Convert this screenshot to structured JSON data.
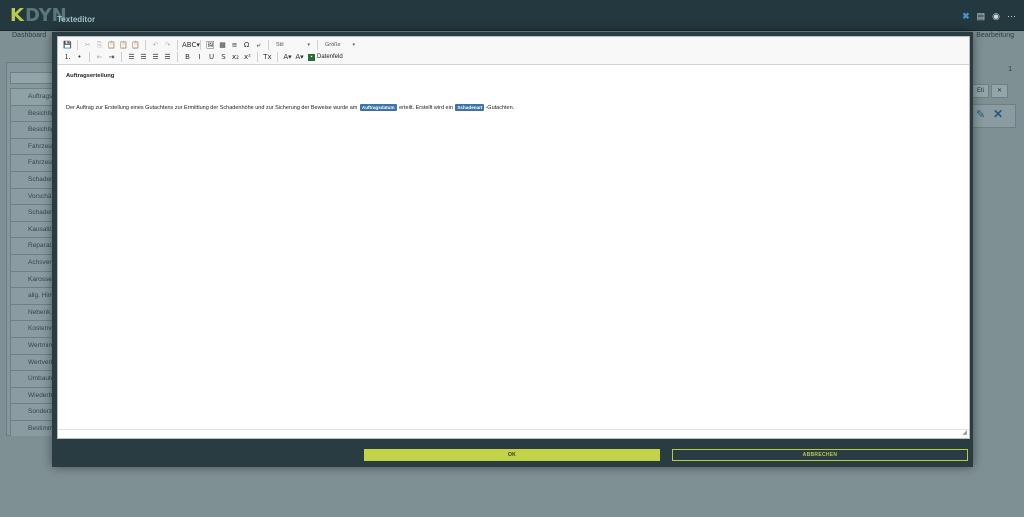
{
  "app": {
    "logo_text": "DYN",
    "logo_mark": "K",
    "subtitle": "Texteditor",
    "top_icons": [
      "close-icon",
      "save-icon",
      "globe-icon",
      "more-icon"
    ]
  },
  "background": {
    "breadcrumb_left": "Dashboard",
    "breadcrumb_right": "Bearbeitung",
    "page_number": "1",
    "list_items": [
      "Auftrags...",
      "Besichtig...",
      "Besichtig...",
      "Fahrzeug...",
      "Fahrzeug...",
      "Schaden...",
      "Vorschä...",
      "Schaden...",
      "Kausalit...",
      "Reparat...",
      "Achsvern...",
      "Karosse...",
      "allg. Hinw...",
      "Nebenk...",
      "Kostenve...",
      "Wertmin...",
      "Wertverb...",
      "Umbaute...",
      "Wiederb...",
      "Sonderz...",
      "Bestimm..."
    ],
    "right_buttons": [
      "Eti",
      "✕"
    ]
  },
  "toolbar": {
    "row1": [
      {
        "icon": "save-icon",
        "glyph": "💾",
        "disabled": false
      },
      {
        "sep": true
      },
      {
        "icon": "cut-icon",
        "glyph": "✂",
        "disabled": true
      },
      {
        "icon": "copy-icon",
        "glyph": "⎘",
        "disabled": true
      },
      {
        "icon": "paste-icon",
        "glyph": "📋",
        "disabled": false
      },
      {
        "icon": "paste-text-icon",
        "glyph": "📋",
        "disabled": false
      },
      {
        "icon": "paste-word-icon",
        "glyph": "📋",
        "disabled": false
      },
      {
        "sep": true
      },
      {
        "icon": "undo-icon",
        "glyph": "↶",
        "disabled": true
      },
      {
        "icon": "redo-icon",
        "glyph": "↷",
        "disabled": true
      },
      {
        "sep": true
      },
      {
        "icon": "spellcheck-icon",
        "glyph": "ABC▾",
        "disabled": false
      },
      {
        "sep": true
      },
      {
        "icon": "image-icon",
        "glyph": "🖼",
        "disabled": false
      },
      {
        "icon": "table-icon",
        "glyph": "▦",
        "disabled": false
      },
      {
        "icon": "horizontal-line-icon",
        "glyph": "≡",
        "disabled": false
      },
      {
        "icon": "special-char-icon",
        "glyph": "Ω",
        "disabled": false
      },
      {
        "icon": "page-break-icon",
        "glyph": "⤶",
        "disabled": false
      }
    ],
    "style_combo": "Stil",
    "size_combo": "Größe",
    "row2": [
      {
        "icon": "numbered-list-icon",
        "glyph": "⒈",
        "disabled": false
      },
      {
        "icon": "bulleted-list-icon",
        "glyph": "•",
        "disabled": false
      },
      {
        "sep": true
      },
      {
        "icon": "outdent-icon",
        "glyph": "⇤",
        "disabled": true
      },
      {
        "icon": "indent-icon",
        "glyph": "⇥",
        "disabled": false
      },
      {
        "sep": true
      },
      {
        "icon": "align-left-icon",
        "glyph": "☰",
        "disabled": false
      },
      {
        "icon": "align-center-icon",
        "glyph": "☰",
        "disabled": false
      },
      {
        "icon": "align-right-icon",
        "glyph": "☰",
        "disabled": false
      },
      {
        "icon": "align-justify-icon",
        "glyph": "☰",
        "disabled": false
      },
      {
        "sep": true
      },
      {
        "icon": "bold-icon",
        "glyph": "B",
        "disabled": false
      },
      {
        "icon": "italic-icon",
        "glyph": "I",
        "disabled": false
      },
      {
        "icon": "underline-icon",
        "glyph": "U",
        "disabled": false
      },
      {
        "icon": "strikethrough-icon",
        "glyph": "S",
        "disabled": false
      },
      {
        "icon": "subscript-icon",
        "glyph": "x₂",
        "disabled": false
      },
      {
        "icon": "superscript-icon",
        "glyph": "x²",
        "disabled": false
      },
      {
        "sep": true
      },
      {
        "icon": "remove-format-icon",
        "glyph": "Tx",
        "disabled": false
      },
      {
        "sep": true
      },
      {
        "icon": "text-color-icon",
        "glyph": "A▾",
        "disabled": false
      },
      {
        "icon": "background-color-icon",
        "glyph": "A▾",
        "disabled": false
      }
    ],
    "datenfeld_label": "Datenfeld"
  },
  "document": {
    "title": "Auftragserteilung",
    "text_1": "Der Auftrag zur Erstellung eines Gutachtens zur Ermittlung der Schadenhöhe und zur Sicherung der Beweise wurde am",
    "chip_1": "Auftragsdatum",
    "text_2": "erteilt. Erstellt wird ein",
    "chip_2": "Schadenart",
    "text_3": "-Gutachten."
  },
  "buttons": {
    "ok_label": "OK",
    "cancel_label": "ABBRECHEN"
  },
  "colors": {
    "accent": "#c2d249",
    "chip": "#3d73a8",
    "modal_bg": "#283c42"
  }
}
